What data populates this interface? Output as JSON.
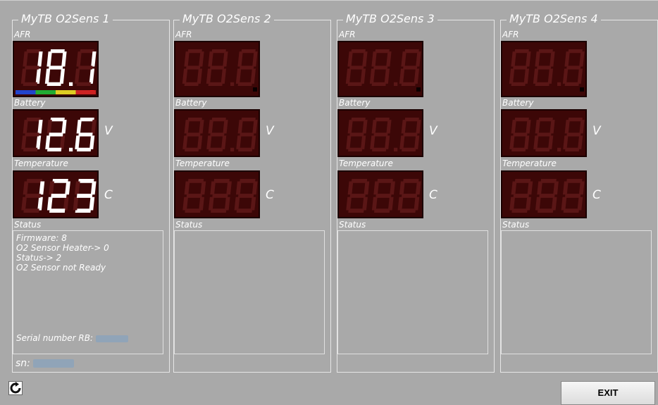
{
  "sensors": [
    {
      "title": "MyTB O2Sens 1",
      "afr_label": "AFR",
      "afr_value": "18.1",
      "battery_label": "Battery",
      "battery_value": "12.6",
      "battery_unit": "V",
      "temperature_label": "Temperature",
      "temperature_value": "123",
      "temperature_unit": "C",
      "status_label": "Status",
      "status_lines": [
        "Firmware: 8",
        "O2 Sensor Heater-> 0",
        "Status-> 2",
        "O2 Sensor not Ready"
      ],
      "serial_label": "Serial number RB:",
      "sn_label": "sn:",
      "afr_bar_colors": [
        "#2244cc",
        "#22aa33",
        "#ddcc22",
        "#cc2222"
      ],
      "active": true
    },
    {
      "title": "MyTB O2Sens 2",
      "afr_label": "AFR",
      "battery_label": "Battery",
      "battery_unit": "V",
      "temperature_label": "Temperature",
      "temperature_unit": "C",
      "status_label": "Status",
      "active": false
    },
    {
      "title": "MyTB O2Sens 3",
      "afr_label": "AFR",
      "battery_label": "Battery",
      "battery_unit": "V",
      "temperature_label": "Temperature",
      "temperature_unit": "C",
      "status_label": "Status",
      "active": false
    },
    {
      "title": "MyTB O2Sens 4",
      "afr_label": "AFR",
      "battery_label": "Battery",
      "battery_unit": "V",
      "temperature_label": "Temperature",
      "temperature_unit": "C",
      "status_label": "Status",
      "active": false
    }
  ],
  "footer": {
    "refresh_icon": "refresh-icon",
    "exit_label": "EXIT"
  },
  "colors": {
    "background": "#a9a9a9",
    "display_bg": "#3c0707",
    "segment_on": "#ffffff",
    "segment_off": "#5a1616"
  }
}
